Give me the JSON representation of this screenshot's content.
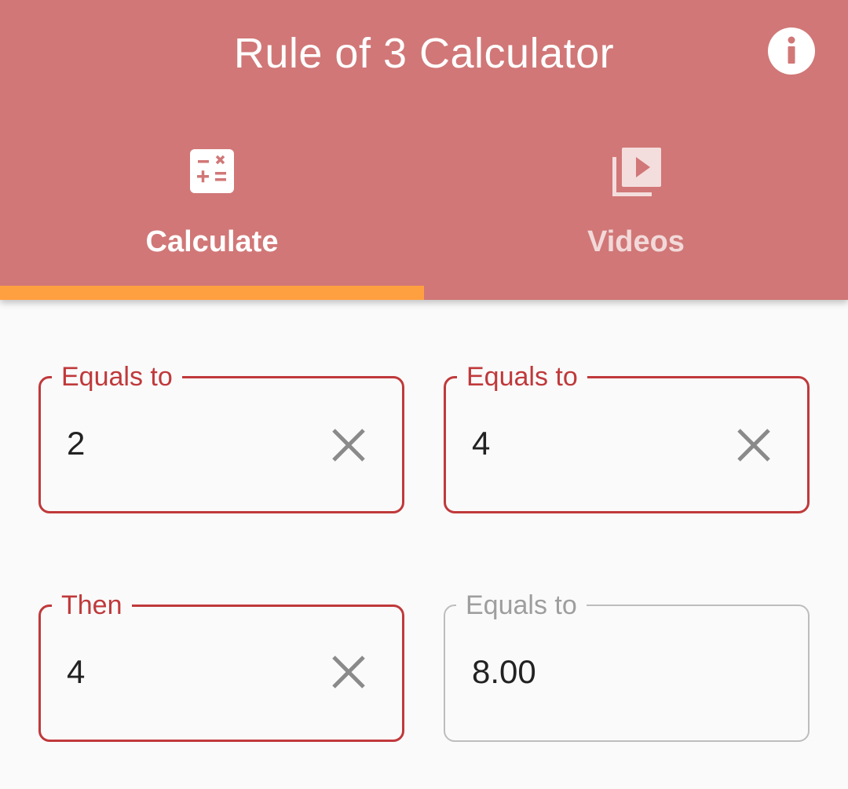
{
  "app_bar": {
    "title": "Rule of 3 Calculator",
    "info_icon": "info-icon",
    "background_color": "#d17777"
  },
  "tabs": [
    {
      "label": "Calculate",
      "icon": "calculator-icon",
      "selected": true
    },
    {
      "label": "Videos",
      "icon": "video-library-icon",
      "selected": false
    }
  ],
  "indicator_color": "#ffa040",
  "fields": {
    "a": {
      "label": "Equals to",
      "value": "2"
    },
    "b": {
      "label": "Equals to",
      "value": "4"
    },
    "c": {
      "label": "Then",
      "value": "4"
    },
    "result": {
      "label": "Equals to",
      "value": "8.00"
    }
  },
  "colors": {
    "field_border_active": "#c0393b",
    "field_border_readonly": "#bdbdbd",
    "clear_icon": "#8a8a8a"
  }
}
